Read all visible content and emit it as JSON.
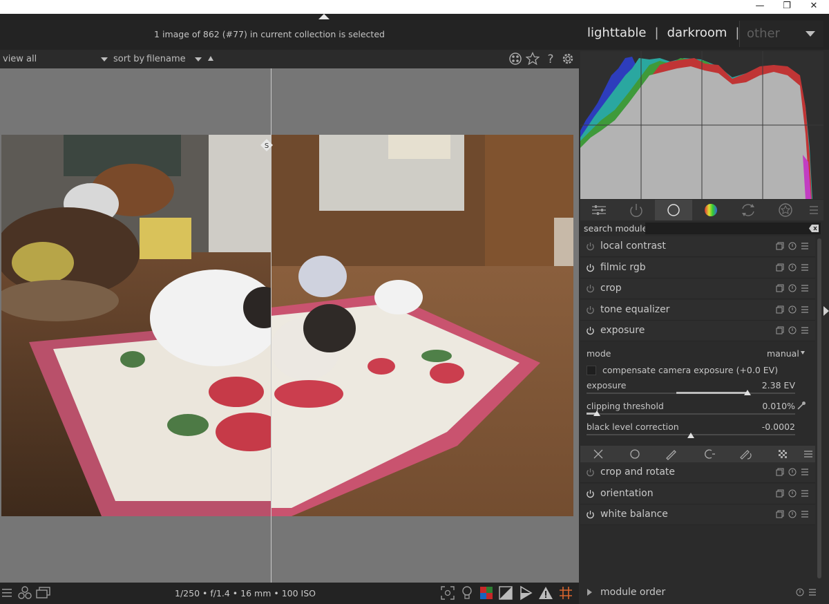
{
  "window": {
    "minimize_icon": "minimize-icon",
    "restore_icon": "restore-icon",
    "close_icon": "close-icon",
    "minimize": "—",
    "restore": "❐",
    "close": "✕"
  },
  "header": {
    "status": "1 image of 862 (#77) in current collection is selected",
    "views": {
      "lighttable": "lighttable",
      "sep1": "|",
      "darkroom": "darkroom",
      "sep2": "|",
      "other": "other"
    }
  },
  "filterbar": {
    "view_label": "view",
    "view_value": "all",
    "sort_label": "sort by",
    "sort_value": "filename",
    "icons": [
      "grouping-icon",
      "star-icon",
      "help-icon",
      "settings-icon"
    ]
  },
  "footer": {
    "exif": "1/250 • f/1.4 • 16 mm • 100 ISO",
    "left_icons": [
      "menu-icon",
      "styles-icon",
      "second-window-icon"
    ],
    "right_icons": [
      "focus-peaking-icon",
      "lightbulb-icon",
      "color-assessment-icon",
      "softproof-icon",
      "gamut-check-icon",
      "overexposed-icon",
      "guides-icon"
    ]
  },
  "split_marker": "S",
  "module_tabs": [
    "quick-access-icon",
    "active-modules-icon",
    "base-modules-icon",
    "color-modules-icon",
    "correction-modules-icon",
    "effects-modules-icon",
    "presets-menu-icon"
  ],
  "search": {
    "label": "search module",
    "value": "",
    "placeholder": ""
  },
  "modules_top": [
    {
      "name": "local contrast",
      "enabled": false
    },
    {
      "name": "filmic rgb",
      "enabled": true
    },
    {
      "name": "crop",
      "enabled": false
    },
    {
      "name": "tone equalizer",
      "enabled": false
    },
    {
      "name": "exposure",
      "enabled": true
    }
  ],
  "exposure": {
    "mode_label": "mode",
    "mode_value": "manual",
    "compensate_label": "compensate camera exposure (+0.0 EV)",
    "compensate_checked": false,
    "exposure_label": "exposure",
    "exposure_value": "2.38 EV",
    "exposure_fraction": 0.77,
    "clipping_label": "clipping threshold",
    "clipping_value": "0.010%",
    "clipping_fraction": 0.05,
    "black_label": "black level correction",
    "black_value": "-0.0002",
    "black_fraction": 0.5
  },
  "mask_icons": [
    "mask-off-icon",
    "uniform-mask-icon",
    "drawn-mask-icon",
    "parametric-mask-icon",
    "drawn-parametric-mask-icon",
    "raster-mask-icon",
    "mask-presets-icon"
  ],
  "modules_bottom": [
    {
      "name": "crop and rotate",
      "enabled": false
    },
    {
      "name": "orientation",
      "enabled": true
    },
    {
      "name": "white balance",
      "enabled": true
    }
  ],
  "module_order": {
    "label": "module order"
  }
}
